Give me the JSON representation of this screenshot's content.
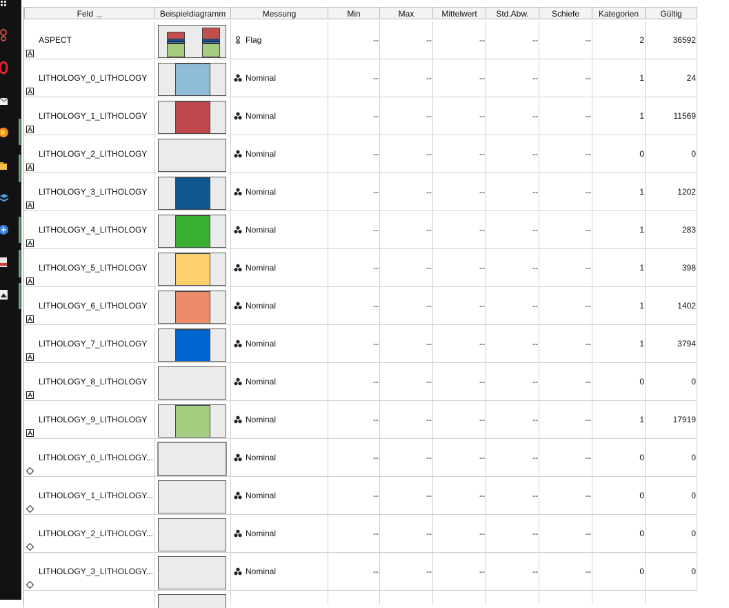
{
  "columns": {
    "feld": "Feld",
    "beispieldiagramm": "Beispieldiagramm",
    "messung": "Messung",
    "min": "Min",
    "max": "Max",
    "mittelwert": "Mittelwert",
    "std_abw": "Std.Abw.",
    "schiefe": "Schiefe",
    "kategorien": "Kategorien",
    "gueltig": "Gültig"
  },
  "sort_icon": "sort-indicator-icon",
  "colors": {
    "header_bg": "#f3f3f3",
    "graph_bg": "#ebebeb",
    "bar_red": "#c0504d",
    "bar_green": "#a6cc7d",
    "bar_blue_dark": "#1a4e8c",
    "bar_blue_mid": "#4a7fc1"
  },
  "rows": [
    {
      "field": "ASPECT",
      "type": "string",
      "measure": "Flag",
      "min": "--",
      "max": "--",
      "mean": "--",
      "std": "--",
      "skew": "--",
      "cats": "2",
      "valid": "36592",
      "graph": "flag",
      "color": ""
    },
    {
      "field": "LITHOLOGY_0_LITHOLOGY",
      "type": "string",
      "measure": "Nominal",
      "min": "--",
      "max": "--",
      "mean": "--",
      "std": "--",
      "skew": "--",
      "cats": "1",
      "valid": "24",
      "graph": "bar",
      "color": "#8fbcd6"
    },
    {
      "field": "LITHOLOGY_1_LITHOLOGY",
      "type": "string",
      "measure": "Nominal",
      "min": "--",
      "max": "--",
      "mean": "--",
      "std": "--",
      "skew": "--",
      "cats": "1",
      "valid": "11569",
      "graph": "bar",
      "color": "#c0474e"
    },
    {
      "field": "LITHOLOGY_2_LITHOLOGY",
      "type": "string",
      "measure": "Nominal",
      "min": "--",
      "max": "--",
      "mean": "--",
      "std": "--",
      "skew": "--",
      "cats": "0",
      "valid": "0",
      "graph": "empty",
      "color": ""
    },
    {
      "field": "LITHOLOGY_3_LITHOLOGY",
      "type": "string",
      "measure": "Nominal",
      "min": "--",
      "max": "--",
      "mean": "--",
      "std": "--",
      "skew": "--",
      "cats": "1",
      "valid": "1202",
      "graph": "bar",
      "color": "#0f5590"
    },
    {
      "field": "LITHOLOGY_4_LITHOLOGY",
      "type": "string",
      "measure": "Nominal",
      "min": "--",
      "max": "--",
      "mean": "--",
      "std": "--",
      "skew": "--",
      "cats": "1",
      "valid": "283",
      "graph": "bar",
      "color": "#39b034"
    },
    {
      "field": "LITHOLOGY_5_LITHOLOGY",
      "type": "string",
      "measure": "Nominal",
      "min": "--",
      "max": "--",
      "mean": "--",
      "std": "--",
      "skew": "--",
      "cats": "1",
      "valid": "398",
      "graph": "bar",
      "color": "#fdd06b"
    },
    {
      "field": "LITHOLOGY_6_LITHOLOGY",
      "type": "string",
      "measure": "Nominal",
      "min": "--",
      "max": "--",
      "mean": "--",
      "std": "--",
      "skew": "--",
      "cats": "1",
      "valid": "1402",
      "graph": "bar",
      "color": "#ee8c6a"
    },
    {
      "field": "LITHOLOGY_7_LITHOLOGY",
      "type": "string",
      "measure": "Nominal",
      "min": "--",
      "max": "--",
      "mean": "--",
      "std": "--",
      "skew": "--",
      "cats": "1",
      "valid": "3794",
      "graph": "bar",
      "color": "#0066d2"
    },
    {
      "field": "LITHOLOGY_8_LITHOLOGY",
      "type": "string",
      "measure": "Nominal",
      "min": "--",
      "max": "--",
      "mean": "--",
      "std": "--",
      "skew": "--",
      "cats": "0",
      "valid": "0",
      "graph": "empty",
      "color": ""
    },
    {
      "field": "LITHOLOGY_9_LITHOLOGY",
      "type": "string",
      "measure": "Nominal",
      "min": "--",
      "max": "--",
      "mean": "--",
      "std": "--",
      "skew": "--",
      "cats": "1",
      "valid": "17919",
      "graph": "bar",
      "color": "#a5cd80"
    },
    {
      "field": "LITHOLOGY_0_LITHOLOGY...",
      "type": "derived",
      "measure": "Nominal",
      "min": "--",
      "max": "--",
      "mean": "--",
      "std": "--",
      "skew": "--",
      "cats": "0",
      "valid": "0",
      "graph": "empty-sel",
      "color": ""
    },
    {
      "field": "LITHOLOGY_1_LITHOLOGY...",
      "type": "derived",
      "measure": "Nominal",
      "min": "--",
      "max": "--",
      "mean": "--",
      "std": "--",
      "skew": "--",
      "cats": "0",
      "valid": "0",
      "graph": "empty",
      "color": ""
    },
    {
      "field": "LITHOLOGY_2_LITHOLOGY...",
      "type": "derived",
      "measure": "Nominal",
      "min": "--",
      "max": "--",
      "mean": "--",
      "std": "--",
      "skew": "--",
      "cats": "0",
      "valid": "0",
      "graph": "empty",
      "color": ""
    },
    {
      "field": "LITHOLOGY_3_LITHOLOGY...",
      "type": "derived",
      "measure": "Nominal",
      "min": "--",
      "max": "--",
      "mean": "--",
      "std": "--",
      "skew": "--",
      "cats": "0",
      "valid": "0",
      "graph": "empty",
      "color": ""
    }
  ]
}
